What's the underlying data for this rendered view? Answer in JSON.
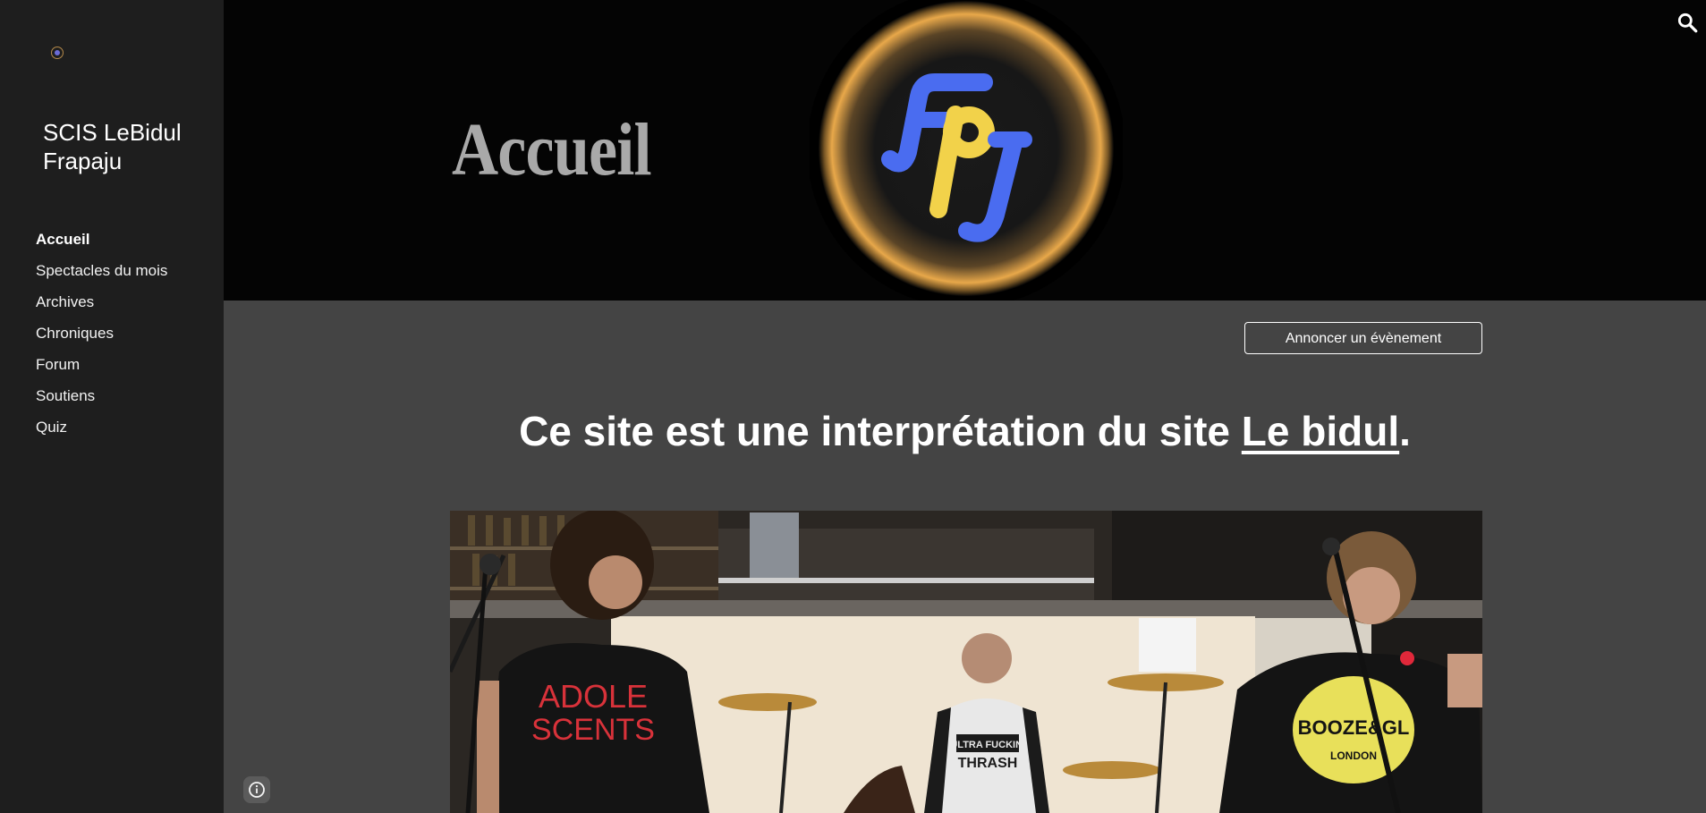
{
  "sidebar": {
    "site_title": "SCIS LeBidul Frapaju",
    "nav": [
      {
        "label": "Accueil",
        "active": true
      },
      {
        "label": "Spectacles du mois",
        "active": false
      },
      {
        "label": "Archives",
        "active": false
      },
      {
        "label": "Chroniques",
        "active": false
      },
      {
        "label": "Forum",
        "active": false
      },
      {
        "label": "Soutiens",
        "active": false
      },
      {
        "label": "Quiz",
        "active": false
      }
    ]
  },
  "header": {
    "page_title": "Accueil",
    "logo": {
      "letters": [
        "F",
        "p",
        "J"
      ],
      "glow_color": "#e8a84a",
      "letter_color": "#4a6cf0",
      "accent_color": "#f2d24a"
    },
    "search_icon": "search-icon"
  },
  "main": {
    "announce_button": "Annoncer un évènement",
    "headline_prefix": "Ce site est une interprétation du site ",
    "headline_link": "Le bidul",
    "headline_suffix": ".",
    "photo": {
      "shirt_left": [
        "ADOLE",
        "SCENTS"
      ],
      "shirt_middle": [
        "ULTRA FUCKIN'",
        "THRASH"
      ],
      "shirt_right": [
        "BOOZE&GL",
        "LONDON"
      ]
    }
  },
  "footer": {
    "info_icon": "info-icon"
  },
  "colors": {
    "sidebar_bg": "#1e1e1e",
    "content_bg": "#444444",
    "header_bg": "#040404"
  }
}
